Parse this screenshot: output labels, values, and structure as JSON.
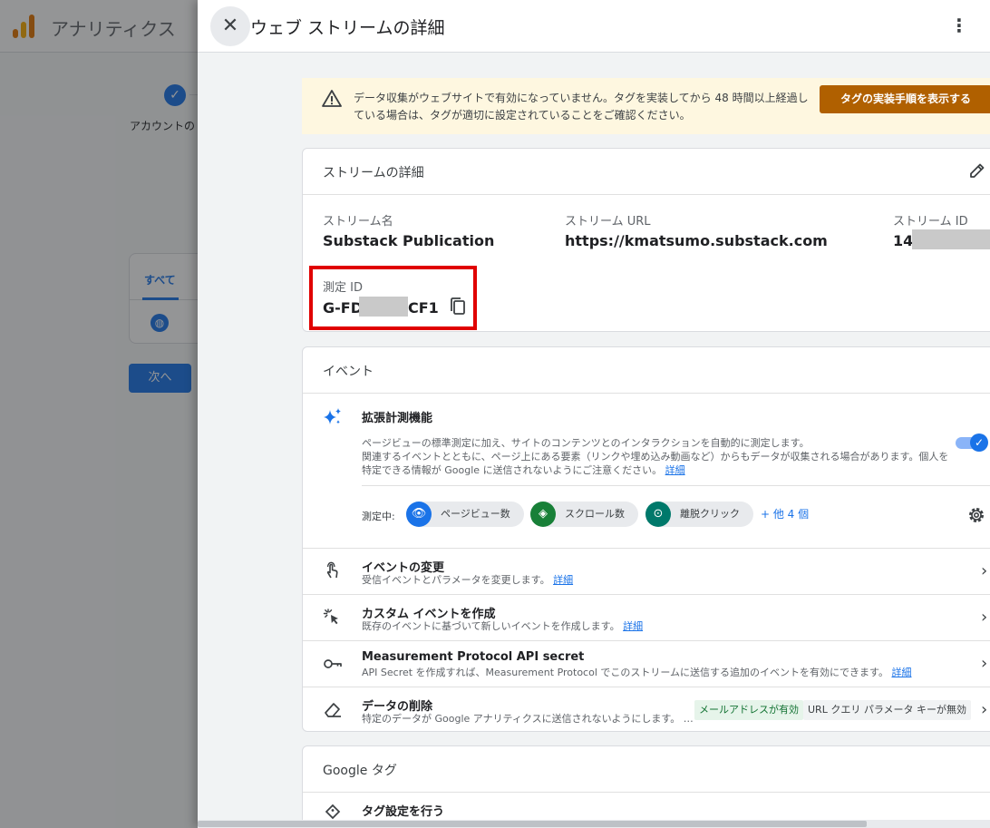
{
  "background": {
    "app_title": "アナリティクス",
    "step_label": "アカウントの",
    "tab_all": "すべて",
    "next_button": "次へ",
    "check_glyph": "✓",
    "globe_glyph": "◍"
  },
  "panel": {
    "title": "ウェブ ストリームの詳細",
    "close_glyph": "✕",
    "more_glyph": "⋮"
  },
  "banner": {
    "text": "データ収集がウェブサイトで有効になっていません。タグを実装してから 48 時間以上経過している場合は、タグが適切に設定されていることをご確認ください。",
    "button": "タグの実装手順を表示する",
    "color": "#fef7e0",
    "button_color": "#b06000"
  },
  "stream_details": {
    "title": "ストリームの詳細",
    "name_label": "ストリーム名",
    "name_value": "Substack Publication",
    "url_label": "ストリーム URL",
    "url_value": "https://kmatsumo.substack.com",
    "id_label": "ストリーム ID",
    "id_value": "14",
    "measurement_label": "測定 ID",
    "measurement_prefix": "G-FD",
    "measurement_suffix": "CF1"
  },
  "events": {
    "title": "イベント",
    "enhanced": {
      "title": "拡張計測機能",
      "desc1": "ページビューの標準測定に加え、サイトのコンテンツとのインタラクションを自動的に測定します。",
      "desc2": "関連するイベントとともに、ページ上にある要素（リンクや埋め込み動画など）からもデータが収集される場合があります。個人を特定できる情報が Google に送信されないようにご注意ください。",
      "desc_link": "詳細",
      "toggle_on": true,
      "measuring_label": "測定中:",
      "chips": [
        {
          "label": "ページビュー数",
          "icon": "eye-icon",
          "glyph": "👁",
          "color": "#1a73e8"
        },
        {
          "label": "スクロール数",
          "icon": "scroll-icon",
          "glyph": "◈",
          "color": "#188038"
        },
        {
          "label": "離脱クリック",
          "icon": "mouse-icon",
          "glyph": "⊙",
          "color": "#00796b"
        }
      ],
      "more_link": "+ 他 4 個"
    },
    "rows": [
      {
        "title": "イベントの変更",
        "desc": "受信イベントとパラメータを変更します。",
        "link": "詳細"
      },
      {
        "title": "カスタム イベントを作成",
        "desc": "既存のイベントに基づいて新しいイベントを作成します。",
        "link": "詳細"
      },
      {
        "title": "Measurement Protocol API secret",
        "desc": "API Secret を作成すれば、Measurement Protocol でこのストリームに送信する追加のイベントを有効にできます。",
        "link": "詳細"
      },
      {
        "title": "データの削除",
        "desc": "特定のデータが Google アナリティクスに送信されないようにします。 …",
        "badge1": "メールアドレスが有効",
        "badge2": "URL クエリ パラメータ キーが無効"
      }
    ]
  },
  "google_tag": {
    "title": "Google タグ",
    "row_title": "タグ設定を行う"
  }
}
